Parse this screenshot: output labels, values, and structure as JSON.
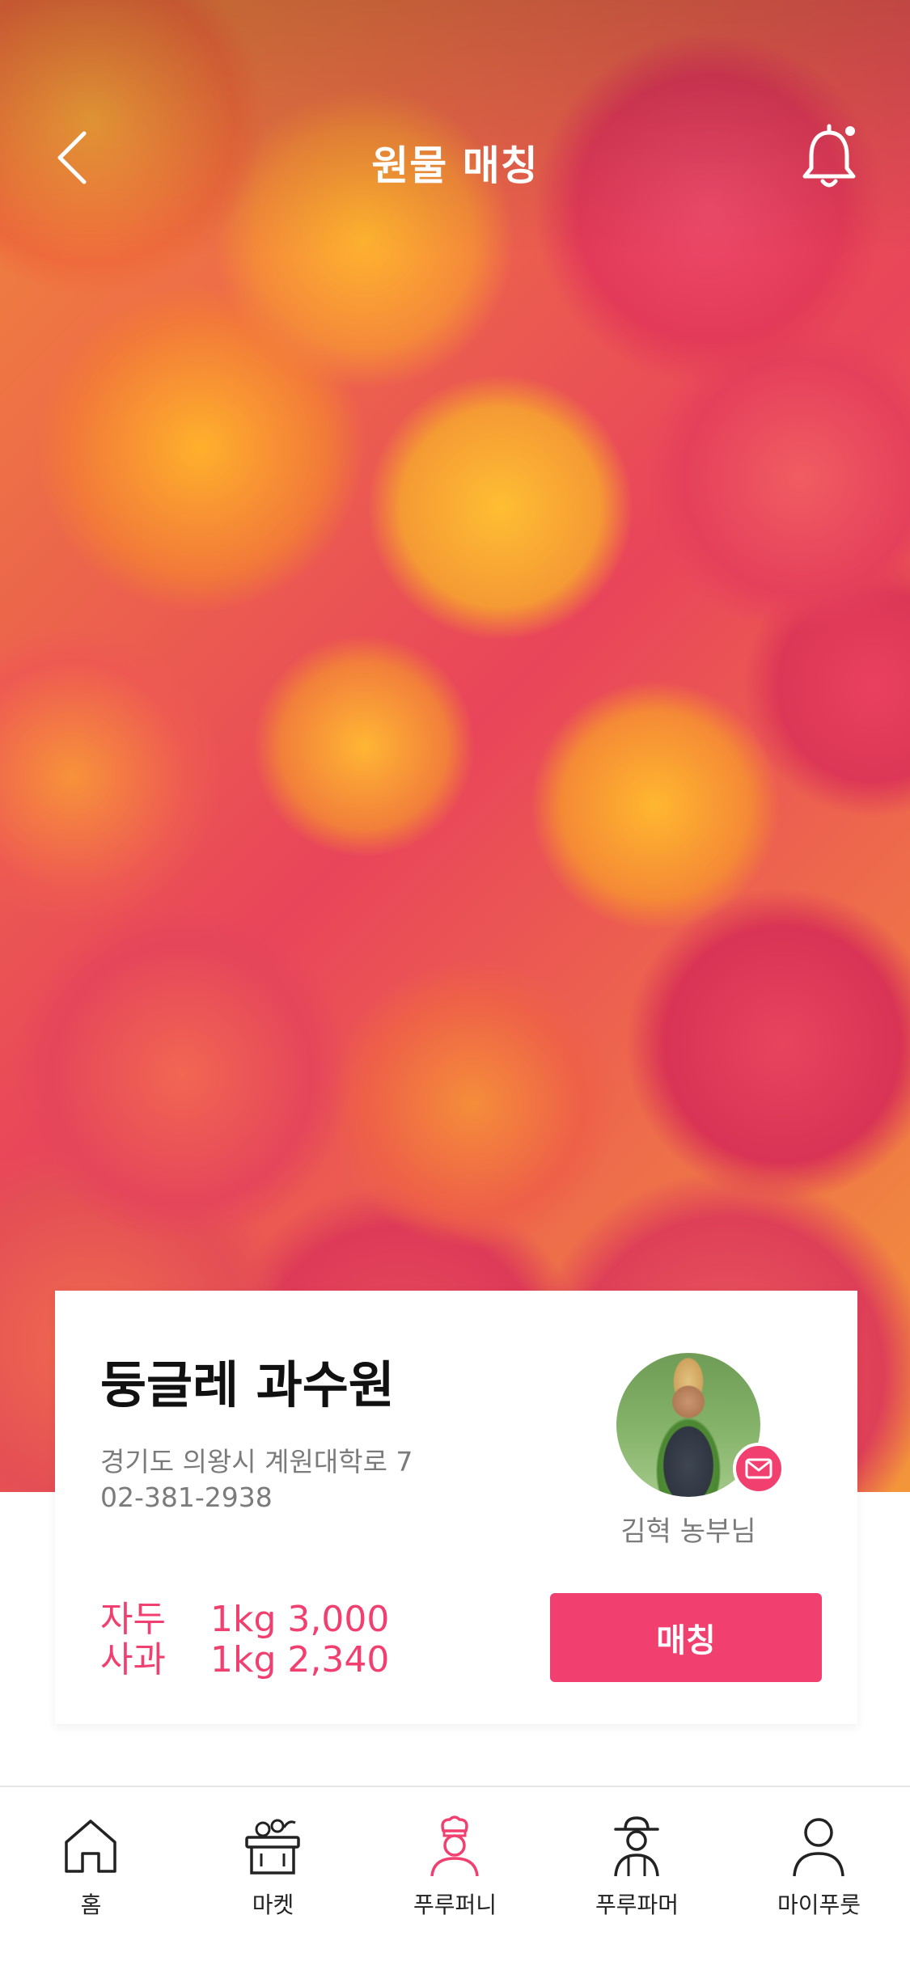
{
  "header": {
    "title": "원물 매칭",
    "back_icon": "chevron-left-icon",
    "bell_icon": "bell-icon"
  },
  "hero": {
    "image": "apricot-pile-photo"
  },
  "card": {
    "shop_name": "둥글레 과수원",
    "address": "경기도 의왕시 계원대학로 7",
    "phone": "02-381-2938",
    "farmer_name": "김혁 농부님",
    "badge_icon": "mail-icon",
    "prices": [
      {
        "item": "자두",
        "price": "1kg 3,000"
      },
      {
        "item": "사과",
        "price": "1kg 2,340"
      }
    ],
    "match_label": "매칭"
  },
  "nav": {
    "items": [
      {
        "label": "홈",
        "icon": "home-icon",
        "active": false
      },
      {
        "label": "마켓",
        "icon": "market-basket-icon",
        "active": false
      },
      {
        "label": "푸루퍼니",
        "icon": "chef-icon",
        "active": true
      },
      {
        "label": "푸루파머",
        "icon": "farmer-icon",
        "active": false
      },
      {
        "label": "마이푸룻",
        "icon": "user-icon",
        "active": false
      }
    ]
  },
  "colors": {
    "accent": "#f13f6f",
    "text_dark": "#111111",
    "text_gray": "#7b7b7b",
    "nav_icon": "#222222"
  }
}
